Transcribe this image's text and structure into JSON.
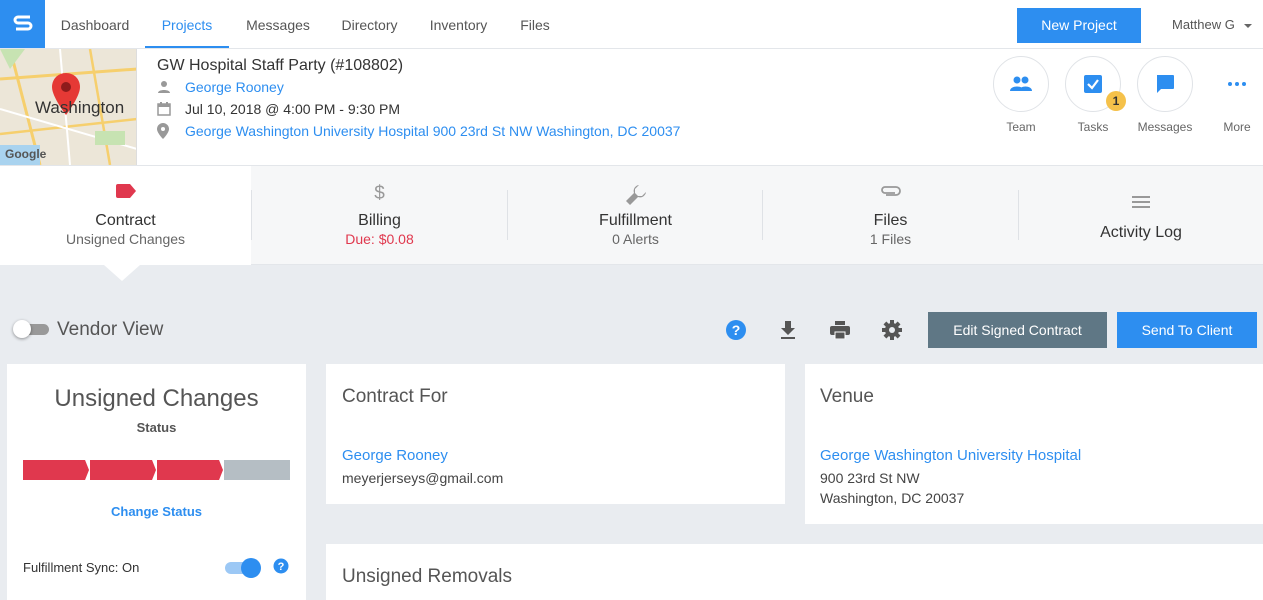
{
  "nav": {
    "tabs": [
      {
        "label": "Dashboard"
      },
      {
        "label": "Projects"
      },
      {
        "label": "Messages"
      },
      {
        "label": "Directory"
      },
      {
        "label": "Inventory"
      },
      {
        "label": "Files"
      }
    ],
    "new_project_label": "New Project",
    "user_name": "Matthew G"
  },
  "map": {
    "city": "Washington",
    "provider": "Google"
  },
  "project": {
    "title": "GW Hospital Staff Party (#108802)",
    "client": "George Rooney",
    "datetime": "Jul 10, 2018 @ 4:00 PM - 9:30 PM",
    "address": "George Washington University Hospital 900 23rd St NW Washington, DC 20037"
  },
  "quick_actions": [
    {
      "label": "Team",
      "icon": "people-icon"
    },
    {
      "label": "Tasks",
      "icon": "checkbox-icon",
      "badge": "1"
    },
    {
      "label": "Messages",
      "icon": "chat-bubble-icon"
    },
    {
      "label": "More",
      "icon": "more-dots-icon"
    }
  ],
  "section_tabs": [
    {
      "title": "Contract",
      "subtitle": "Unsigned Changes",
      "icon": "tag-icon"
    },
    {
      "title": "Billing",
      "subtitle": "Due: $0.08",
      "icon": "dollar-icon"
    },
    {
      "title": "Fulfillment",
      "subtitle": "0 Alerts",
      "icon": "wrench-icon"
    },
    {
      "title": "Files",
      "subtitle": "1 Files",
      "icon": "paperclip-icon"
    },
    {
      "title": "Activity Log",
      "subtitle": "",
      "icon": "list-icon"
    }
  ],
  "toolbar": {
    "vendor_view_label": "Vendor View",
    "vendor_view_on": false,
    "edit_signed_label": "Edit Signed Contract",
    "send_to_client_label": "Send To Client"
  },
  "status_card": {
    "title": "Unsigned Changes",
    "subtitle": "Status",
    "progress_steps_done": 3,
    "progress_steps_total": 4,
    "change_status_label": "Change Status",
    "sync_label": "Fulfillment Sync: On",
    "sync_on": true
  },
  "contract_for": {
    "heading": "Contract For",
    "name": "George Rooney",
    "email": "meyerjerseys@gmail.com"
  },
  "venue": {
    "heading": "Venue",
    "name": "George Washington University Hospital",
    "street": "900 23rd St NW",
    "city_line": "Washington, DC 20037"
  },
  "removals": {
    "heading": "Unsigned Removals"
  },
  "colors": {
    "accent": "#2d8ef0",
    "danger": "#e0384e",
    "dark_button": "#5f7785",
    "badge": "#f5c14a"
  }
}
